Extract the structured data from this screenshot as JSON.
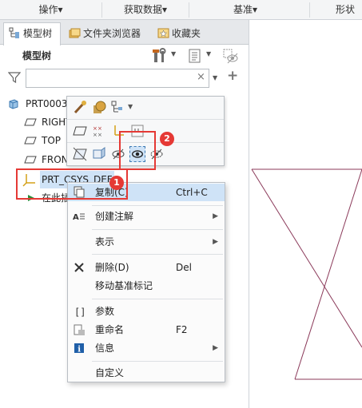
{
  "ribbon": {
    "items": [
      "操作▾",
      "获取数据▾",
      "基准▾",
      "形状"
    ]
  },
  "tabs": [
    {
      "label": "模型树",
      "icon": "model-tree-icon"
    },
    {
      "label": "文件夹浏览器",
      "icon": "folder-browser-icon"
    },
    {
      "label": "收藏夹",
      "icon": "favorites-icon"
    }
  ],
  "tree": {
    "title": "模型树",
    "search_placeholder": "",
    "items": [
      {
        "label": "PRT0003.",
        "icon": "part-icon"
      },
      {
        "label": "RIGHT",
        "icon": "datum-plane-icon"
      },
      {
        "label": "TOP",
        "icon": "datum-plane-icon"
      },
      {
        "label": "FRON",
        "icon": "datum-plane-icon"
      },
      {
        "label": "PRT_CSYS_DEF",
        "icon": "csys-icon"
      },
      {
        "label": "在此插",
        "icon": "insert-here-icon"
      }
    ]
  },
  "badges": {
    "one": "1",
    "two": "2"
  },
  "context_menu": {
    "items": [
      {
        "label": "复制(C)",
        "shortcut": "Ctrl+C",
        "icon": "copy-icon"
      },
      {
        "label": "创建注解",
        "icon": "annotation-icon",
        "submenu": true
      },
      {
        "label": "表示",
        "submenu": true
      },
      {
        "label": "删除(D)",
        "shortcut": "Del",
        "icon": "delete-icon"
      },
      {
        "label": "移动基准标记"
      },
      {
        "label": "参数",
        "icon": "parameters-icon"
      },
      {
        "label": "重命名",
        "shortcut": "F2",
        "icon": "rename-icon"
      },
      {
        "label": "信息",
        "icon": "info-icon",
        "submenu": true
      },
      {
        "label": "自定义"
      }
    ],
    "submenu_arrow": "▶"
  },
  "colors": {
    "highlight_red": "#e53935",
    "selection_blue": "#cfe3f7",
    "sketch_line": "#8b3a5a"
  }
}
